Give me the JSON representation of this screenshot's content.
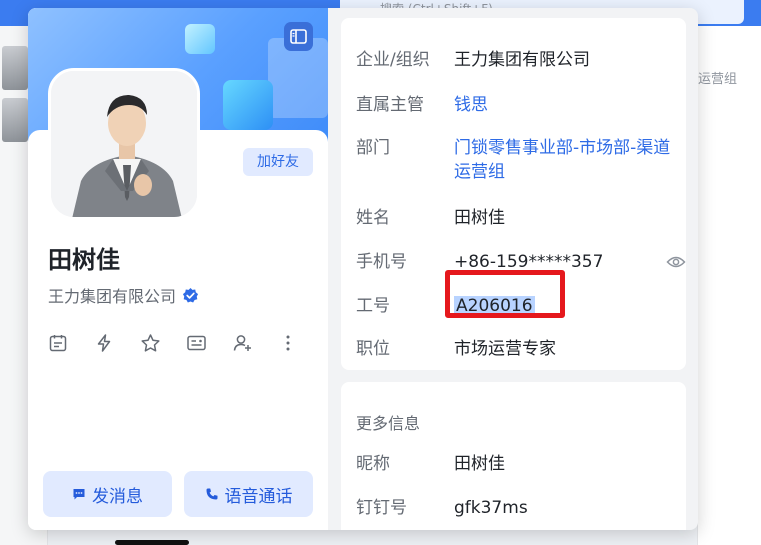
{
  "background": {
    "search_text": "搜索 (Ctrl+Shift+F)",
    "right_snippet": "道运营组"
  },
  "profile": {
    "add_friend": "加好友",
    "name": "田树佳",
    "company": "王力集团有限公司",
    "message_btn": "发消息",
    "call_btn": "语音通话",
    "action_icons": [
      "calendar-icon",
      "flash-icon",
      "star-icon",
      "card-icon",
      "add-contact-icon",
      "more-icon"
    ]
  },
  "details": {
    "org_label": "企业/组织",
    "org_value": "王力集团有限公司",
    "manager_label": "直属主管",
    "manager_value": "钱思",
    "dept_label": "部门",
    "dept_value": "门锁零售事业部-市场部-渠道运营组",
    "name_label": "姓名",
    "name_value": "田树佳",
    "phone_label": "手机号",
    "phone_value": "+86-159*****357",
    "empid_label": "工号",
    "empid_value": "A206016",
    "title_label": "职位",
    "title_value": "市场运营专家"
  },
  "more": {
    "section_title": "更多信息",
    "nick_label": "昵称",
    "nick_value": "田树佳",
    "dd_label": "钉钉号",
    "dd_value": "gfk37ms"
  },
  "colors": {
    "accent": "#2e6be6",
    "highlight": "#e5181d"
  }
}
